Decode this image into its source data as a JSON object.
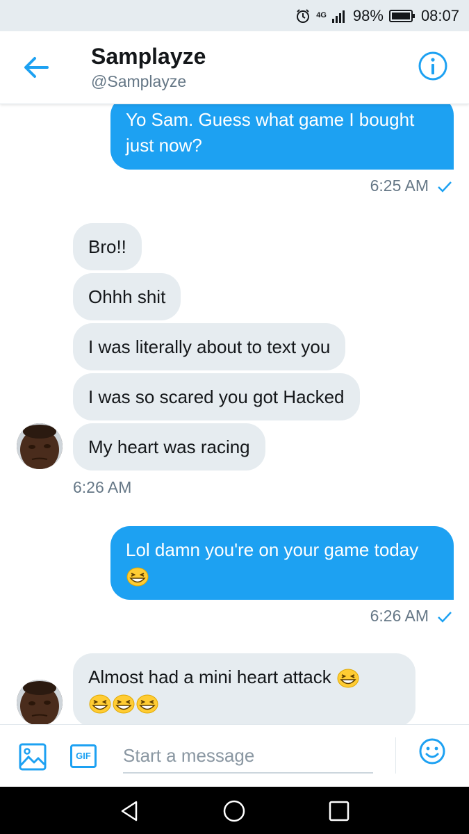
{
  "status_bar": {
    "network": "4G",
    "battery": "98%",
    "time": "08:07"
  },
  "header": {
    "title": "Samplayze",
    "handle": "@Samplayze"
  },
  "messages": [
    {
      "type": "sent",
      "text": "Yo Sam. Guess what game I bought just now?",
      "time": "6:25 AM"
    },
    {
      "type": "received",
      "text": "Bro!!"
    },
    {
      "type": "received",
      "text": "Ohhh shit"
    },
    {
      "type": "received",
      "text": "I was literally about to text you"
    },
    {
      "type": "received",
      "text": "I was so scared you got Hacked"
    },
    {
      "type": "received",
      "text": "My heart was racing",
      "time": "6:26 AM"
    },
    {
      "type": "sent",
      "text": "Lol damn you're on your game today",
      "emoji": "grinning-squinting-face",
      "time": "6:26 AM"
    },
    {
      "type": "received",
      "text": "Almost had a mini heart attack",
      "emoji": "grinning-squinting-face",
      "emoji_count": 4
    }
  ],
  "composer": {
    "placeholder": "Start a message",
    "gif_label": "GIF"
  },
  "icons": [
    "back-arrow-icon",
    "info-icon",
    "alarm-icon",
    "signal-icon",
    "battery-icon",
    "image-icon",
    "gif-icon",
    "emoji-icon",
    "nav-back-icon",
    "nav-home-icon",
    "nav-recents-icon"
  ],
  "colors": {
    "accent": "#1da1f2",
    "received_bubble": "#e6ecf0",
    "text": "#14171a",
    "muted": "#657786"
  }
}
